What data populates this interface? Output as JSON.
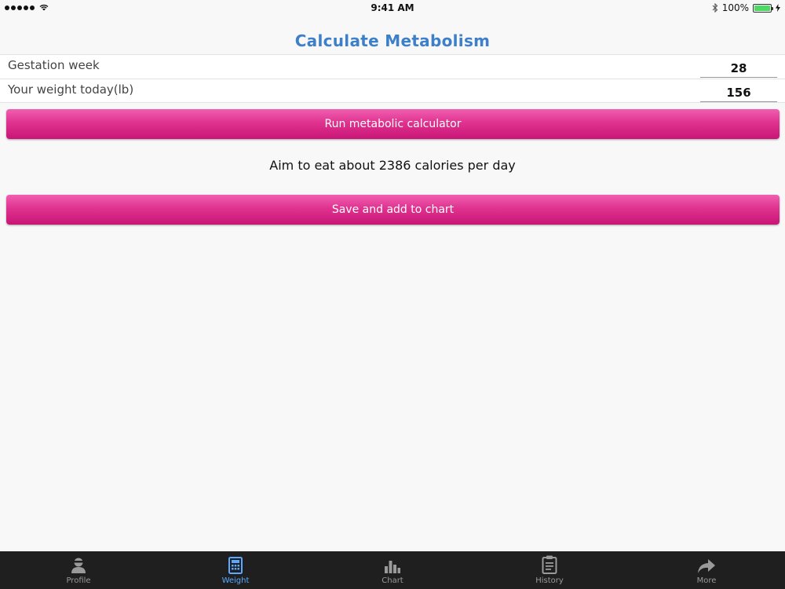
{
  "status_bar": {
    "time": "9:41 AM",
    "battery_text": "100%"
  },
  "page": {
    "title": "Calculate Metabolism"
  },
  "form": {
    "rows": [
      {
        "label": "Gestation week",
        "value": "28"
      },
      {
        "label": "Your weight today(lb)",
        "value": "156"
      }
    ]
  },
  "buttons": {
    "run_label": "Run metabolic calculator",
    "save_label": "Save and add to chart"
  },
  "result": {
    "text": "Aim to eat about 2386 calories per day"
  },
  "tab_bar": {
    "active_color": "#5aa9ff",
    "inactive_color": "#9a9a9a",
    "tabs": [
      {
        "label": "Profile",
        "icon": "profile-icon"
      },
      {
        "label": "Weight",
        "icon": "calculator-icon",
        "active": true
      },
      {
        "label": "Chart",
        "icon": "bar-chart-icon"
      },
      {
        "label": "History",
        "icon": "clipboard-icon"
      },
      {
        "label": "More",
        "icon": "share-arrow-icon"
      }
    ]
  },
  "colors": {
    "title": "#3d7fc8",
    "button_pink": "#e0338f",
    "battery": "#4cd964"
  }
}
